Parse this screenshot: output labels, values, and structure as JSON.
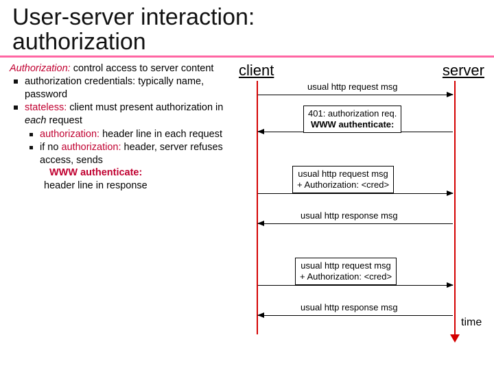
{
  "title_l1": "User-server interaction:",
  "title_l2": "authorization",
  "left": {
    "auth_word": "Authorization:",
    "auth_rest": " control access to server content",
    "b1a": "authorization credentials: typically name, password",
    "b2a_stateless": "stateless:",
    "b2a_rest": " client must present authorization in ",
    "b2a_each": "each",
    "b2a_rest2": " request",
    "s1a": "authorization:",
    "s1b": " header line in each request",
    "s2a": "if no ",
    "s2b": "authorization:",
    "s2c": " header, server refuses access, sends",
    "www": "WWW authenticate:",
    "resp": "header line in response"
  },
  "right": {
    "client": "client",
    "server": "server",
    "time": "time",
    "m1": "usual http request msg",
    "box1_l1": "401: authorization req.",
    "box1_l2": "WWW authenticate:",
    "box2_l1": "usual http request msg",
    "box2_l2": "+  Authorization: <cred>",
    "m3": "usual http response msg",
    "box3_l1": "usual http request msg",
    "box3_l2": "+ Authorization: <cred>",
    "m5": "usual http response msg"
  }
}
